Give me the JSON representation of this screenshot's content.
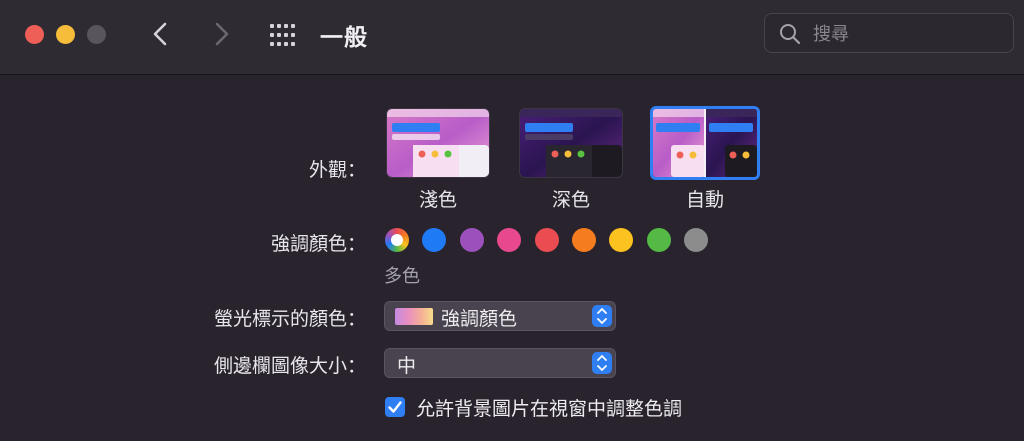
{
  "window": {
    "title": "一般",
    "search_placeholder": "搜尋"
  },
  "appearance": {
    "label": "外觀：",
    "options": [
      {
        "label": "淺色",
        "selected": false
      },
      {
        "label": "深色",
        "selected": false
      },
      {
        "label": "自動",
        "selected": true
      }
    ]
  },
  "accent": {
    "label": "強調顏色：",
    "selected_name": "多色",
    "colors": [
      "multicolor",
      "#1f7bf5",
      "#9b51b9",
      "#e8488e",
      "#ea4c51",
      "#f47d20",
      "#fcc21f",
      "#55b945",
      "#8c8c8c"
    ]
  },
  "highlight": {
    "label": "螢光標示的顏色：",
    "value": "強調顏色"
  },
  "sidebar_icon": {
    "label": "側邊欄圖像大小：",
    "value": "中"
  },
  "wallpaper_tint": {
    "label": "允許背景圖片在視窗中調整色調",
    "checked": true
  },
  "colors": {
    "accent_blue": "#2f7ff2",
    "background": "#29232e"
  }
}
